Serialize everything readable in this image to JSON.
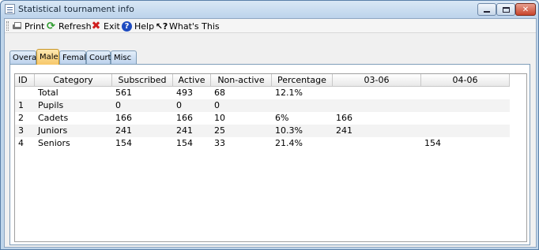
{
  "window": {
    "title": "Statistical tournament info"
  },
  "toolbar": {
    "print": "Print",
    "refresh": "Refresh",
    "exit": "Exit",
    "help": "Help",
    "whats_this": "What's This"
  },
  "tabs": [
    {
      "label": "Overall",
      "active": false
    },
    {
      "label": "Male",
      "active": true
    },
    {
      "label": "Female",
      "active": false
    },
    {
      "label": "Courts",
      "active": false
    },
    {
      "label": "Misc",
      "active": false
    }
  ],
  "table": {
    "headers": [
      "ID",
      "Category",
      "Subscribed",
      "Active",
      "Non-active",
      "Percentage",
      "03-06",
      "04-06"
    ],
    "rows": [
      {
        "id": "",
        "category": "Total",
        "subscribed": "561",
        "active": "493",
        "nonactive": "68",
        "percentage": "12.1%",
        "c0306": "",
        "c0406": ""
      },
      {
        "id": "1",
        "category": "Pupils",
        "subscribed": "0",
        "active": "0",
        "nonactive": "0",
        "percentage": "",
        "c0306": "",
        "c0406": ""
      },
      {
        "id": "2",
        "category": "Cadets",
        "subscribed": "166",
        "active": "166",
        "nonactive": "10",
        "percentage": "6%",
        "c0306": "166",
        "c0406": ""
      },
      {
        "id": "3",
        "category": "Juniors",
        "subscribed": "241",
        "active": "241",
        "nonactive": "25",
        "percentage": "10.3%",
        "c0306": "241",
        "c0406": ""
      },
      {
        "id": "4",
        "category": "Seniors",
        "subscribed": "154",
        "active": "154",
        "nonactive": "33",
        "percentage": "21.4%",
        "c0306": "",
        "c0406": "154"
      }
    ]
  },
  "colors": {
    "active_tab": "#f7c86a",
    "inactive_tab": "#bcd2ec",
    "alt_row": "#f3f3f3"
  }
}
